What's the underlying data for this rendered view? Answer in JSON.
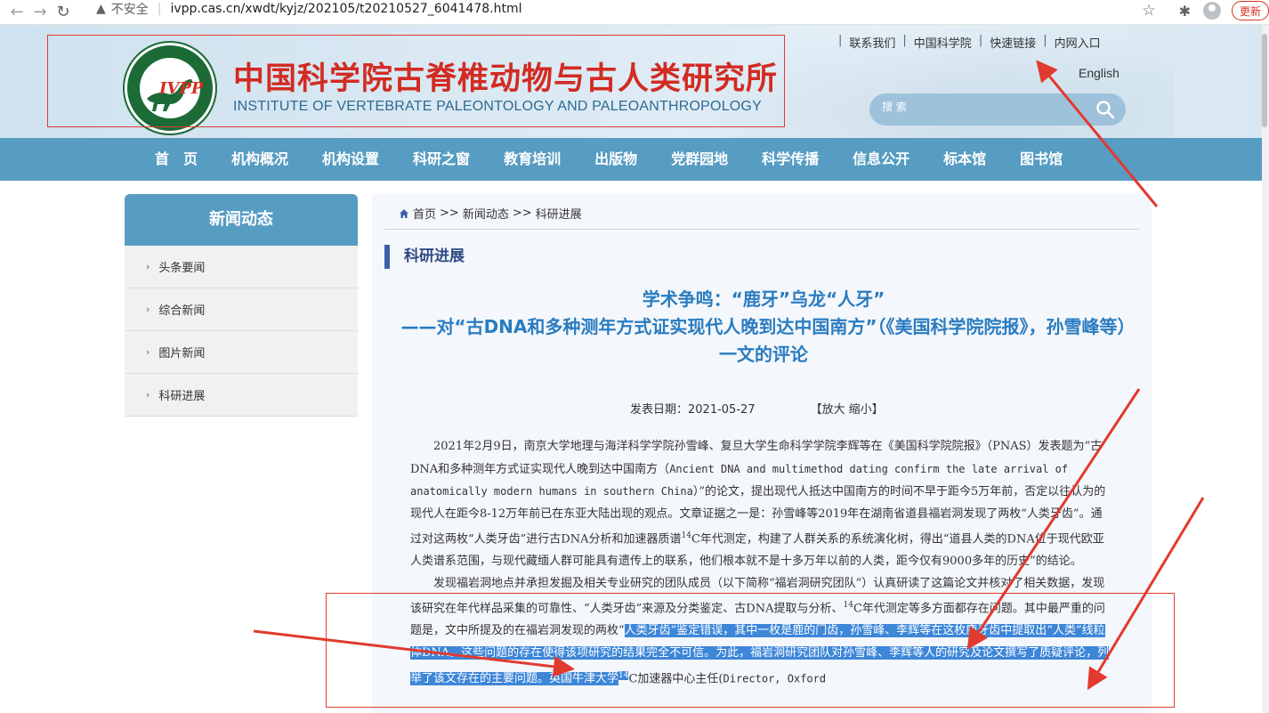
{
  "browser": {
    "security_label": "不安全",
    "url": "ivpp.cas.cn/xwdt/kyjz/202105/t20210527_6041478.html",
    "update_label": "更新"
  },
  "header": {
    "logo_text": "IVPP",
    "title_cn": "中国科学院古脊椎动物与古人类研究所",
    "title_en": "INSTITUTE OF VERTEBRATE PALEONTOLOGY AND PALEOANTHROPOLOGY",
    "top_links": [
      "联系我们",
      "中国科学院",
      "快速链接",
      "内网入口"
    ],
    "english_label": "English",
    "search_placeholder": "搜 索"
  },
  "nav": [
    "首　页",
    "机构概况",
    "机构设置",
    "科研之窗",
    "教育培训",
    "出版物",
    "党群园地",
    "科学传播",
    "信息公开",
    "标本馆",
    "图书馆"
  ],
  "sidebar": {
    "heading": "新闻动态",
    "items": [
      "头条要闻",
      "综合新闻",
      "图片新闻",
      "科研进展"
    ]
  },
  "main": {
    "breadcrumb": [
      "首页",
      ">>",
      "新闻动态",
      ">>",
      "科研进展"
    ],
    "section_title": "科研进展",
    "title_line1": "学术争鸣：“鹿牙”乌龙“人牙”",
    "title_line2": "——对“古DNA和多种测年方式证实现代人晚到达中国南方”（《美国科学院院报》，孙雪峰等）一文的评论",
    "pubdate": "发表日期：2021-05-27",
    "zoom": "【放大 缩小】",
    "p1_a": "2021年2月9日，南京大学地理与海洋科学学院孙雪峰、复旦大学生命科学学院李辉等在《美国科学院院报》（PNAS）发表题为“古DNA和多种测年方式证实现代人晚到达中国南方（",
    "p1_mono": "Ancient DNA and multimethod dating confirm the late arrival of anatomically modern humans in southern China",
    "p1_b": "）”的论文，提出现代人抵达中国南方的时间不早于距今5万年前，否定以往认为的现代人在距今8-12万年前已在东亚大陆出现的观点。文章证据之一是：孙雪峰等2019年在湖南省道县福岩洞发现了两枚“人类牙齿”。通过对这两枚“人类牙齿”进行古DNA分析和加速器质谱",
    "p1_sup": "14",
    "p1_c": "C年代测定，构建了人群关系的系统演化树，得出“道县人类的DNA位于现代欧亚人类谱系范围，与现代藏缅人群可能具有遗传上的联系，他们根本就不是十多万年以前的人类，距今仅有9000多年的历史”的结论。",
    "p2_a": "发现福岩洞地点并承担发掘及相关专业研究的团队成员（以下简称“福岩洞研究团队”）认真研读了这篇论文并核对了相关数据，发现该研究在年代样品采集的可靠性、“人类牙齿”来源及分类鉴定、古DNA提取与分析、",
    "p2_sup": "14",
    "p2_b": "C年代测定等多方面都存在问题。其中最严重的问题是，文中所提及的在福岩洞发现的两枚“",
    "p2_hl1": "人类牙齿”鉴定错误，其中一枚是鹿的门齿，孙雪峰、李辉等在这枚鹿牙齿中提取出“人类”线粒体DNA。这些问题的存在使得该项研究的结果完全不可信。为此，福岩洞研究团队对孙雪峰、李辉等人的研究及论文撰写了质疑评论，列举了该文存在的主要问题。英国牛津大学",
    "p2_sup2": "14",
    "p2_c": "C加速器中心主任(",
    "p2_mono": "Director, Oxford"
  },
  "colors": {
    "nav_bg": "#579cc2",
    "title_red": "#d22b22",
    "title_blue": "#2a7cc1",
    "highlight": "#3d86d8",
    "annotation_red": "#e23a2f"
  }
}
